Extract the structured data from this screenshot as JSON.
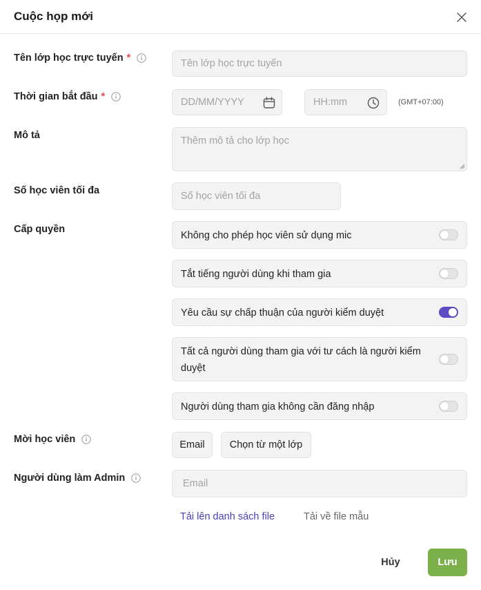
{
  "dialog": {
    "title": "Cuộc họp mới"
  },
  "form": {
    "class_name": {
      "label": "Tên lớp học trực tuyến",
      "required_mark": "*",
      "placeholder": "Tên lớp học trực tuyến",
      "value": ""
    },
    "start_time": {
      "label": "Thời gian bắt đầu",
      "required_mark": "*",
      "date_placeholder": "DD/MM/YYYY",
      "time_placeholder": "HH:mm",
      "timezone": "(GMT+07:00)"
    },
    "description": {
      "label": "Mô tả",
      "placeholder": "Thêm mô tả cho lớp học",
      "value": ""
    },
    "max_students": {
      "label": "Số học viên tối đa",
      "placeholder": "Số học viên tối đa",
      "value": ""
    },
    "permissions": {
      "label": "Cấp quyền",
      "items": [
        {
          "text": "Không cho phép học viên sử dụng mic",
          "enabled": false
        },
        {
          "text": "Tắt tiếng người dùng khi tham gia",
          "enabled": false
        },
        {
          "text": "Yêu cầu sự chấp thuận của người kiểm duyệt",
          "enabled": true
        },
        {
          "text": "Tất cả người dùng tham gia với tư cách là người kiểm duyệt",
          "enabled": false
        },
        {
          "text": "Người dùng tham gia không cần đăng nhập",
          "enabled": false
        }
      ]
    },
    "invite": {
      "label": "Mời học viên",
      "email_button": "Email",
      "from_class_button": "Chọn từ một lớp"
    },
    "admin": {
      "label": "Người dùng làm Admin",
      "placeholder": "Email",
      "value": ""
    },
    "links": {
      "upload_list": "Tải lên danh sách file",
      "download_template": "Tải về file mẫu"
    }
  },
  "actions": {
    "cancel": "Hủy",
    "save": "Lưu"
  },
  "colors": {
    "accent": "#5b4bc4",
    "save": "#7bb04b",
    "required": "#e5484d",
    "link": "#4a3fb5"
  }
}
